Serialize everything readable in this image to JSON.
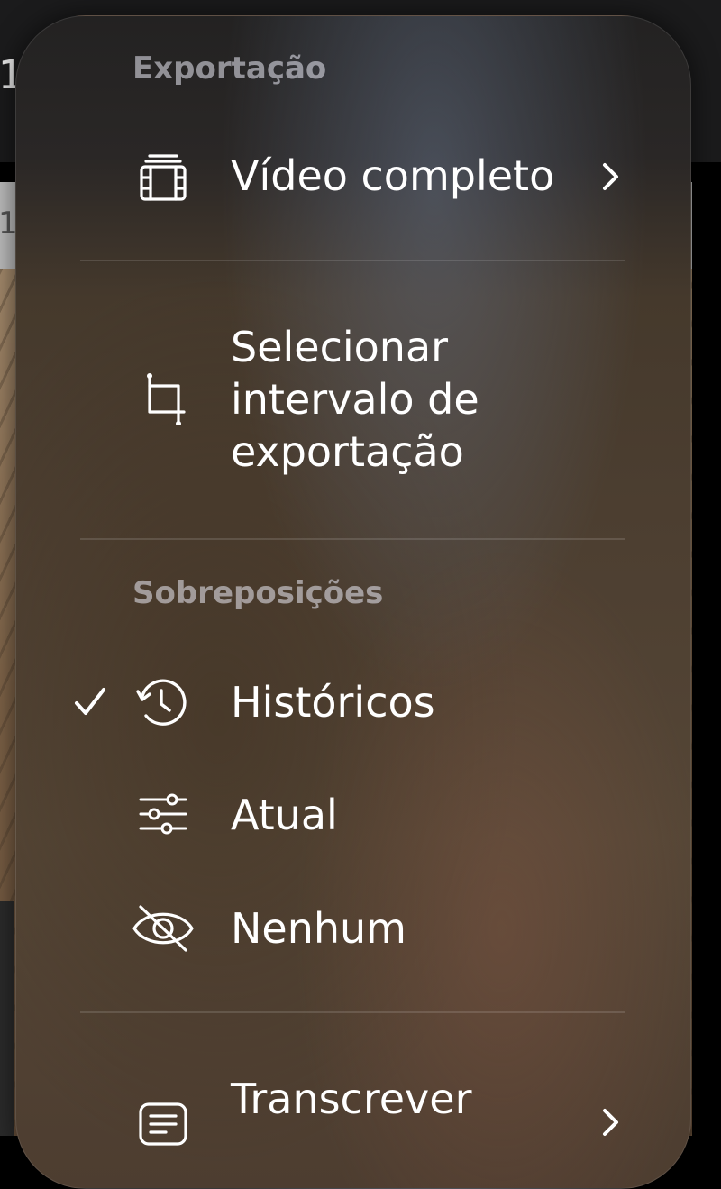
{
  "background": {
    "topbar_char": "1",
    "strip_char": "1"
  },
  "menu": {
    "export_section": {
      "header": "Exportação",
      "items": [
        {
          "label": "Vídeo completo",
          "icon": "film-icon",
          "has_submenu": true
        },
        {
          "label": "Selecionar intervalo de exportação",
          "icon": "crop-icon",
          "has_submenu": false
        }
      ]
    },
    "overlays_section": {
      "header": "Sobreposições",
      "items": [
        {
          "label": "Históricos",
          "icon": "history-icon",
          "checked": true
        },
        {
          "label": "Atual",
          "icon": "sliders-icon",
          "checked": false
        },
        {
          "label": "Nenhum",
          "icon": "eye-slash-icon",
          "checked": false
        }
      ]
    },
    "transcribe_item": {
      "label": "Transcrever",
      "icon": "text-bubble-icon",
      "has_submenu": true
    }
  },
  "colors": {
    "menu_text": "#FFFFFF",
    "section_header": "#9A9A9E",
    "separator": "#5A524A"
  }
}
